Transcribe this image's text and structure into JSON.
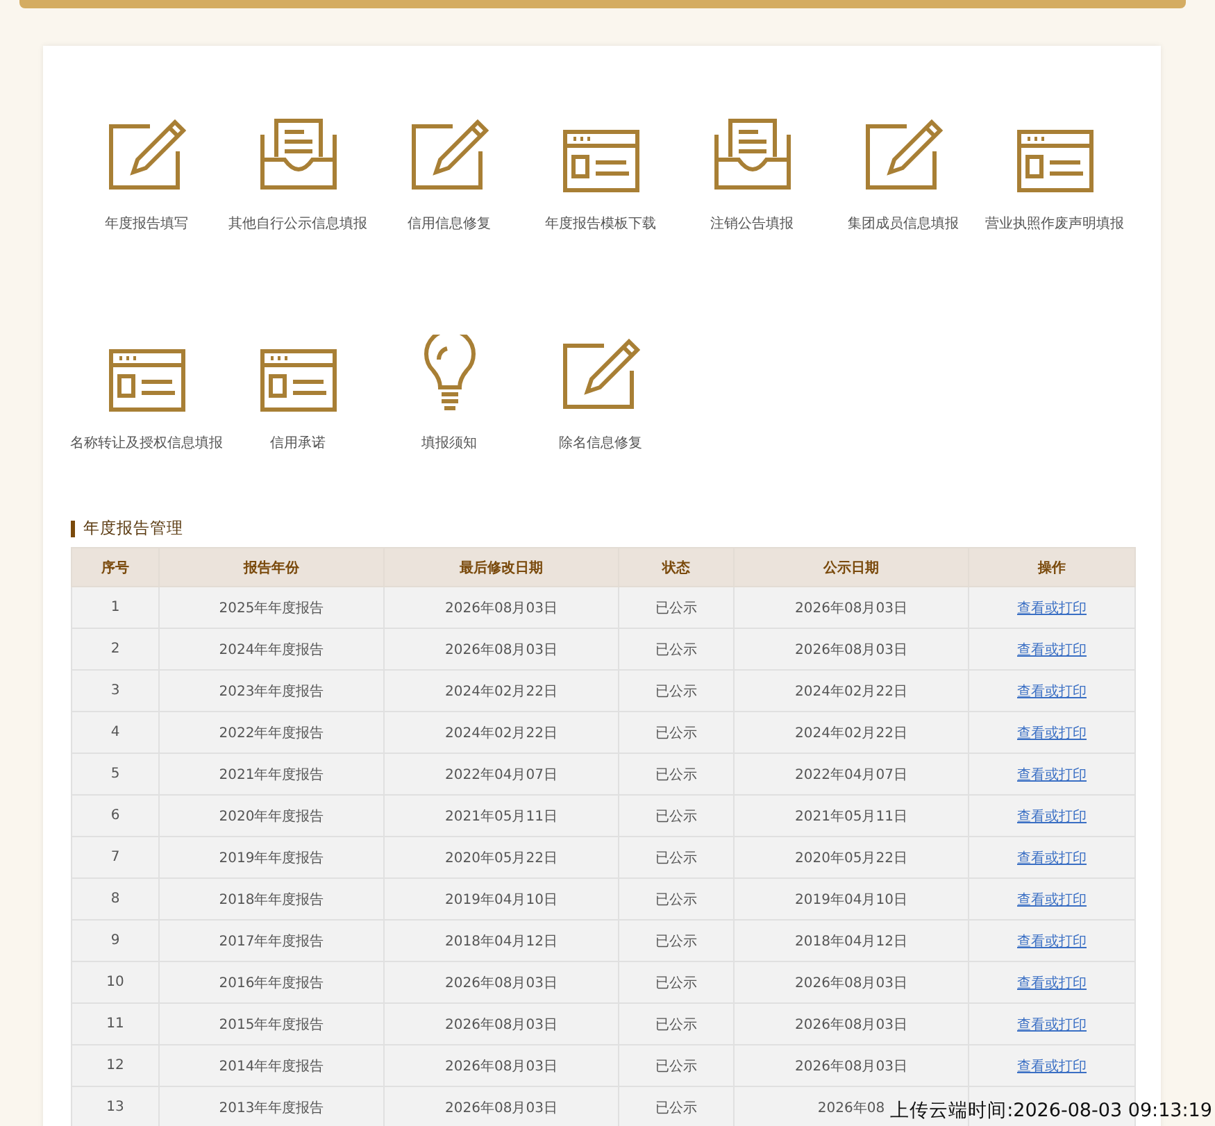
{
  "shortcuts": [
    {
      "label": "年度报告填写"
    },
    {
      "label": "其他自行公示信息填报"
    },
    {
      "label": "信用信息修复"
    },
    {
      "label": "年度报告模板下载"
    },
    {
      "label": "注销公告填报"
    },
    {
      "label": "集团成员信息填报"
    },
    {
      "label": "营业执照作废声明填报"
    },
    {
      "label": "名称转让及授权信息填报"
    },
    {
      "label": "信用承诺"
    },
    {
      "label": "填报须知"
    },
    {
      "label": "除名信息修复"
    }
  ],
  "section_title": "年度报告管理",
  "table": {
    "columns": [
      "序号",
      "报告年份",
      "最后修改日期",
      "状态",
      "公示日期",
      "操作"
    ],
    "rows": [
      [
        "1",
        "2025年年度报告",
        "2026年08月03日",
        "已公示",
        "2026年08月03日",
        "查看或打印"
      ],
      [
        "2",
        "2024年年度报告",
        "2026年08月03日",
        "已公示",
        "2026年08月03日",
        "查看或打印"
      ],
      [
        "3",
        "2023年年度报告",
        "2024年02月22日",
        "已公示",
        "2024年02月22日",
        "查看或打印"
      ],
      [
        "4",
        "2022年年度报告",
        "2024年02月22日",
        "已公示",
        "2024年02月22日",
        "查看或打印"
      ],
      [
        "5",
        "2021年年度报告",
        "2022年04月07日",
        "已公示",
        "2022年04月07日",
        "查看或打印"
      ],
      [
        "6",
        "2020年年度报告",
        "2021年05月11日",
        "已公示",
        "2021年05月11日",
        "查看或打印"
      ],
      [
        "7",
        "2019年年度报告",
        "2020年05月22日",
        "已公示",
        "2020年05月22日",
        "查看或打印"
      ],
      [
        "8",
        "2018年年度报告",
        "2019年04月10日",
        "已公示",
        "2019年04月10日",
        "查看或打印"
      ],
      [
        "9",
        "2017年年度报告",
        "2018年04月12日",
        "已公示",
        "2018年04月12日",
        "查看或打印"
      ],
      [
        "10",
        "2016年年度报告",
        "2026年08月03日",
        "已公示",
        "2026年08月03日",
        "查看或打印"
      ],
      [
        "11",
        "2015年年度报告",
        "2026年08月03日",
        "已公示",
        "2026年08月03日",
        "查看或打印"
      ],
      [
        "12",
        "2014年年度报告",
        "2026年08月03日",
        "已公示",
        "2026年08月03日",
        "查看或打印"
      ],
      [
        "13",
        "2013年年度报告",
        "2026年08月03日",
        "已公示",
        "2026年08"
      ]
    ]
  },
  "upload_stamp": "上传云端时间:2026-08-03 09:13:19"
}
